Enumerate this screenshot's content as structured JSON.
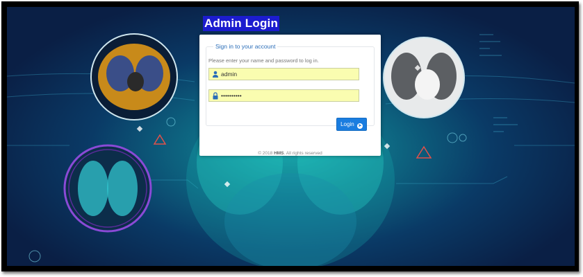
{
  "page": {
    "title": "Admin Login"
  },
  "login_panel": {
    "legend": "Sign in to your account",
    "hint": "Please enter your name and password to log in.",
    "username_value": "admin",
    "password_value": "••••••••••",
    "login_button_label": "Login",
    "login_button_icon": "arrow-circle-right-icon"
  },
  "footer": {
    "year_text": "© 2018",
    "brand": "HMS",
    "rights": ". All rights reserved"
  },
  "colors": {
    "title_bg": "#1c1ccf",
    "legend": "#2a6db8",
    "input_bg": "#fafdb0",
    "button": "#1a7de0"
  }
}
